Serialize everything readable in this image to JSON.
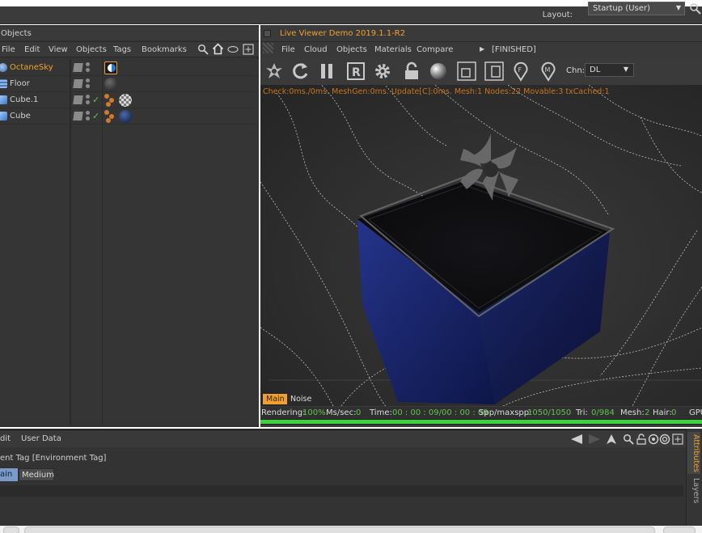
{
  "layout": {
    "label": "Layout:",
    "value": "Startup (User)"
  },
  "objects_panel": {
    "title": "Objects",
    "menu": [
      "File",
      "Edit",
      "View",
      "Objects",
      "Tags",
      "Bookmarks"
    ],
    "rows": [
      {
        "name": "OctaneSky",
        "selected": true
      },
      {
        "name": "Floor",
        "selected": false
      },
      {
        "name": "Cube.1",
        "selected": false
      },
      {
        "name": "Cube",
        "selected": false
      }
    ]
  },
  "live_viewer": {
    "title": "Live Viewer Demo 2019.1.1-R2",
    "menu": [
      "File",
      "Cloud",
      "Objects",
      "Materials",
      "Compare"
    ],
    "state": "[FINISHED]",
    "channel_label": "Chn:",
    "channel_value": "DL",
    "stats": "Check:0ms./0ms. MeshGen:0ms. Update[C]:0ms. Mesh:1 Nodes:22 Movable:3 txCached:1",
    "tabs": [
      "Main",
      "Noise"
    ],
    "status": {
      "rendering_label": "Rendering:",
      "rendering_value": "100%",
      "mssec_label": "Ms/sec:",
      "mssec_value": "0",
      "time_label": "Time:",
      "time_value": "00 : 00 : 09/00 : 00 : 09",
      "spp_label": "Spp/maxspp:",
      "spp_value": "1050/1050",
      "tri_label": "Tri:",
      "tri_value": "0/984",
      "mesh_label": "Mesh:",
      "mesh_value": "2",
      "hair_label": "Hair:",
      "hair_value": "0",
      "gpu_label": "GPU"
    },
    "progress_fraction": 1.0
  },
  "attributes": {
    "menu": [
      "Edit",
      "User Data"
    ],
    "menu_visible": [
      "dit",
      "User Data"
    ],
    "title_visible": "ent Tag [Environment Tag]",
    "buttons": [
      "ain",
      "Medium"
    ],
    "side_tabs": [
      "Attributes",
      "Layers"
    ]
  },
  "colors": {
    "accent": "#f0a030",
    "progress": "#3cd23c",
    "check": "#61c24f"
  }
}
